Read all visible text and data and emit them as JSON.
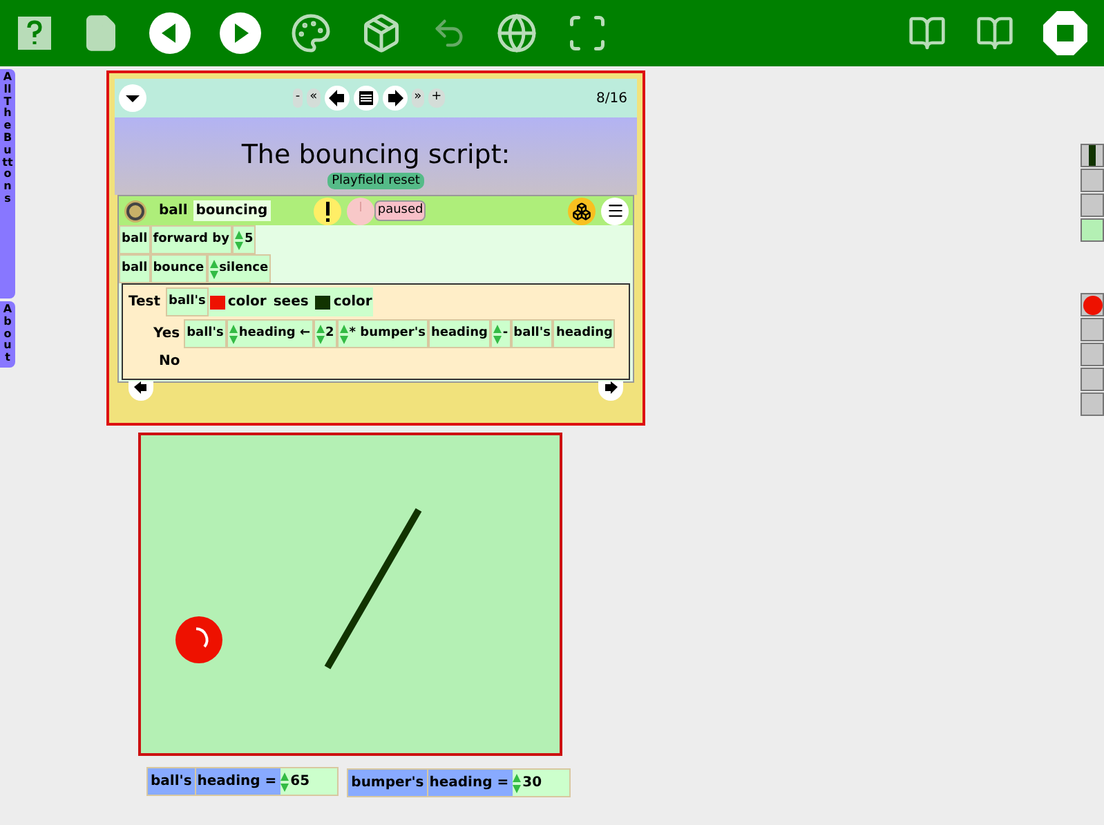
{
  "flaps": [
    {
      "label": "All The Buttons",
      "kind": "tall"
    },
    {
      "label": "About",
      "kind": "short"
    }
  ],
  "book": {
    "nav": {
      "left": [
        "-",
        "«"
      ],
      "right": [
        "»",
        "+"
      ]
    },
    "page_indicator": "8/16",
    "title": "The bouncing script:",
    "reset_button": "Playfield reset",
    "script": {
      "player": "ball",
      "name": "bouncing",
      "status": "paused",
      "rows": [
        [
          {
            "text": "ball",
            "arrows": false
          },
          {
            "text": "forward by",
            "arrows": false
          },
          {
            "text": "5",
            "arrows": true
          }
        ],
        [
          {
            "text": "ball",
            "arrows": false
          },
          {
            "text": "bounce",
            "arrows": false
          },
          {
            "text": "silence",
            "arrows": true
          }
        ]
      ],
      "test": {
        "label": "Test",
        "yes_label": "Yes",
        "no_label": "No",
        "condition": [
          {
            "text": "ball's",
            "kind": "word"
          },
          {
            "text": "color",
            "kind": "swatch",
            "color": "#ee1100"
          },
          {
            "text": "sees",
            "kind": "plain"
          },
          {
            "text": "color",
            "kind": "swatch",
            "color": "#113300"
          }
        ],
        "yes": [
          {
            "text": "ball's",
            "kind": "word"
          },
          {
            "text": "heading ←",
            "kind": "arrows"
          },
          {
            "text": "2",
            "kind": "arrows"
          },
          {
            "text": "* bumper's",
            "kind": "arrows"
          },
          {
            "text": "heading",
            "kind": "word"
          },
          {
            "text": "-",
            "kind": "arrows"
          },
          {
            "text": "ball's",
            "kind": "word"
          },
          {
            "text": "heading",
            "kind": "word"
          }
        ]
      }
    }
  },
  "watchers": [
    {
      "object": "ball's",
      "attribute": "heading =",
      "value": "65"
    },
    {
      "object": "bumper's",
      "attribute": "heading =",
      "value": "30"
    }
  ]
}
